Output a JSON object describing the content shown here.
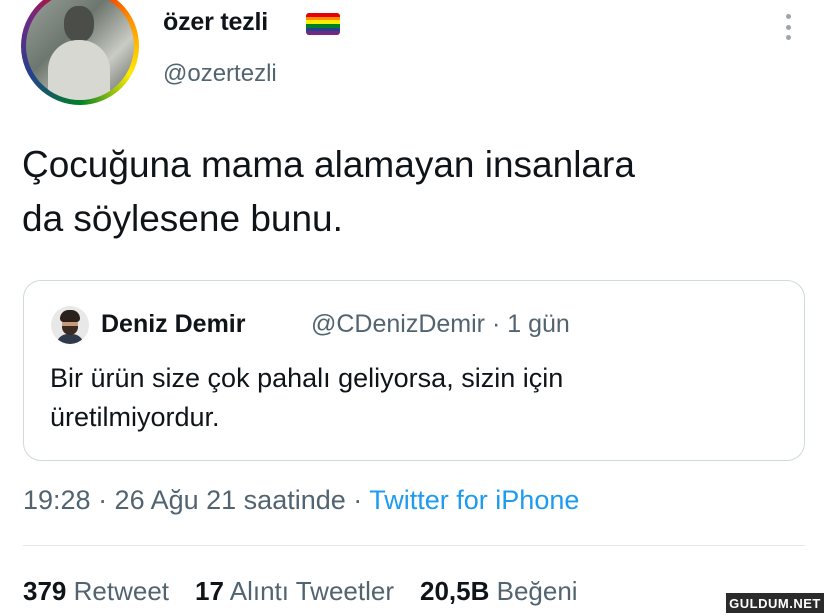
{
  "author": {
    "display_name": "özer tezli",
    "handle": "@ozertezli",
    "flag_colors": [
      "#e40303",
      "#ff8c00",
      "#ffed00",
      "#008026",
      "#24408e",
      "#732982"
    ]
  },
  "icons": {
    "more": "more-vertical-icon",
    "flag": "rainbow-flag-icon"
  },
  "tweet": {
    "text_line1": "Çocuğuna mama alamayan insanlara",
    "text_line2": "da söylesene bunu."
  },
  "quoted": {
    "display_name": "Deniz Demir",
    "handle_time": "@CDenizDemir · 1 gün",
    "text_line1": "Bir ürün size çok pahalı geliyorsa, sizin için",
    "text_line2": "üretilmiyordur."
  },
  "meta": {
    "time_date": "19:28 · 26 Ağu 21 saatinde · ",
    "source": "Twitter for iPhone"
  },
  "stats": [
    {
      "count": "379",
      "label": "Retweet"
    },
    {
      "count": "17",
      "label": "Alıntı Tweetler"
    },
    {
      "count": "20,5B",
      "label": "Beğeni"
    }
  ],
  "watermark": "GULDUM.NET",
  "colors": {
    "link": "#1d9bf0",
    "secondary_text": "#536471",
    "primary_text": "#0f1419",
    "border": "#cfd9de"
  }
}
